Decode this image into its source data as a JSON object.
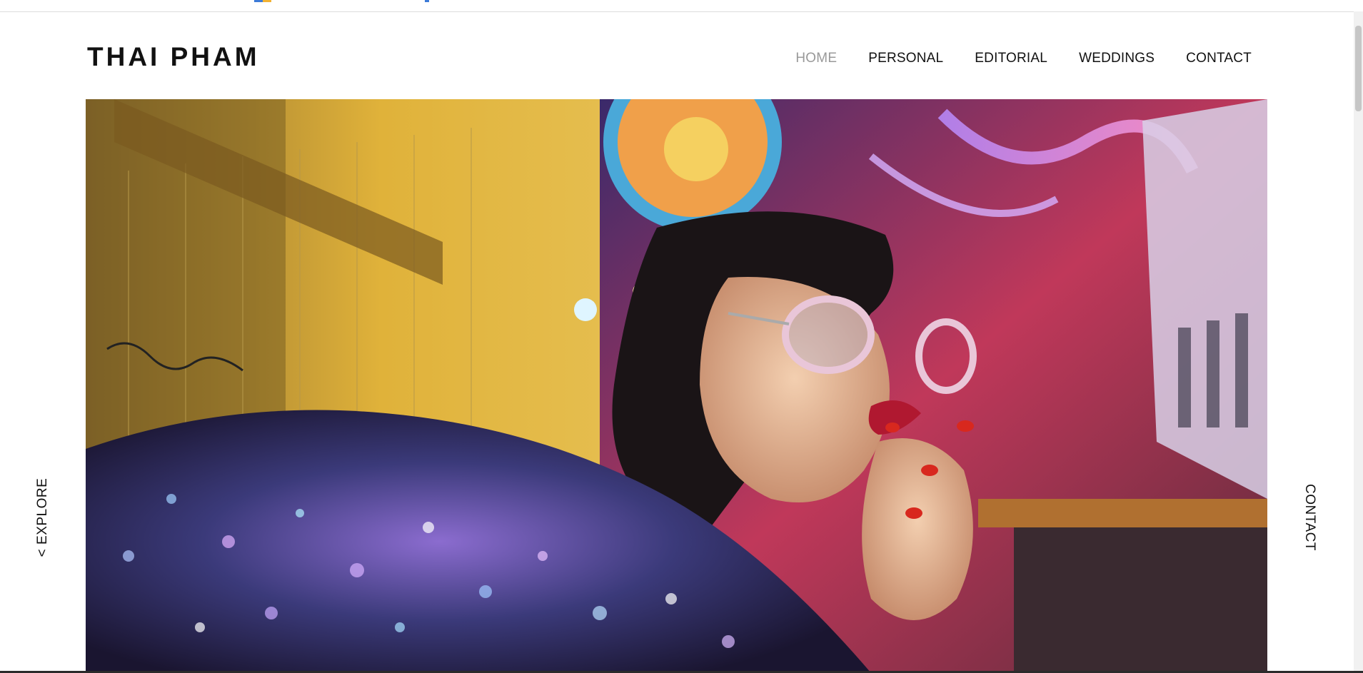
{
  "site": {
    "logo_text": "THAI PHAM"
  },
  "nav": {
    "items": [
      {
        "label": "HOME",
        "active": true
      },
      {
        "label": "PERSONAL",
        "active": false
      },
      {
        "label": "EDITORIAL",
        "active": false
      },
      {
        "label": "WEDDINGS",
        "active": false
      },
      {
        "label": "CONTACT",
        "active": false
      }
    ]
  },
  "side_nav": {
    "left_label": "< EXPLORE",
    "right_label": "CONTACT"
  },
  "hero": {
    "icon": "photo-image",
    "subject": "neon-night-fashion-portrait"
  },
  "colors": {
    "text": "#111111",
    "active_nav": "#999999",
    "background": "#ffffff"
  }
}
